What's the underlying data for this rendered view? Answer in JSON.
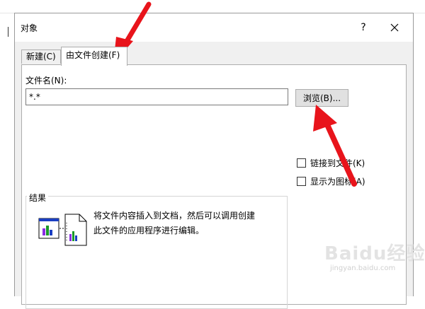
{
  "dialog": {
    "title": "对象",
    "help": "?",
    "close_icon": "close-icon"
  },
  "tabs": [
    {
      "label": "新建(C)",
      "active": false
    },
    {
      "label": "由文件创建(F)",
      "active": true
    }
  ],
  "file": {
    "label": "文件名(N):",
    "value": "*.*",
    "browse": "浏览(B)..."
  },
  "options": {
    "link": "链接到文件(K)",
    "display_icon": "显示为图标(A)"
  },
  "result": {
    "label": "结果",
    "text": "将文件内容插入到文档，然后可以调用创建此文件的应用程序进行编辑。"
  },
  "watermark": {
    "brand": "Baidu经验",
    "sub": "jingyan.baidu.com"
  },
  "colors": {
    "annotation_arrow": "#e8141b",
    "tab_border": "#adadad",
    "dialog_bg": "#f0f0f0"
  }
}
